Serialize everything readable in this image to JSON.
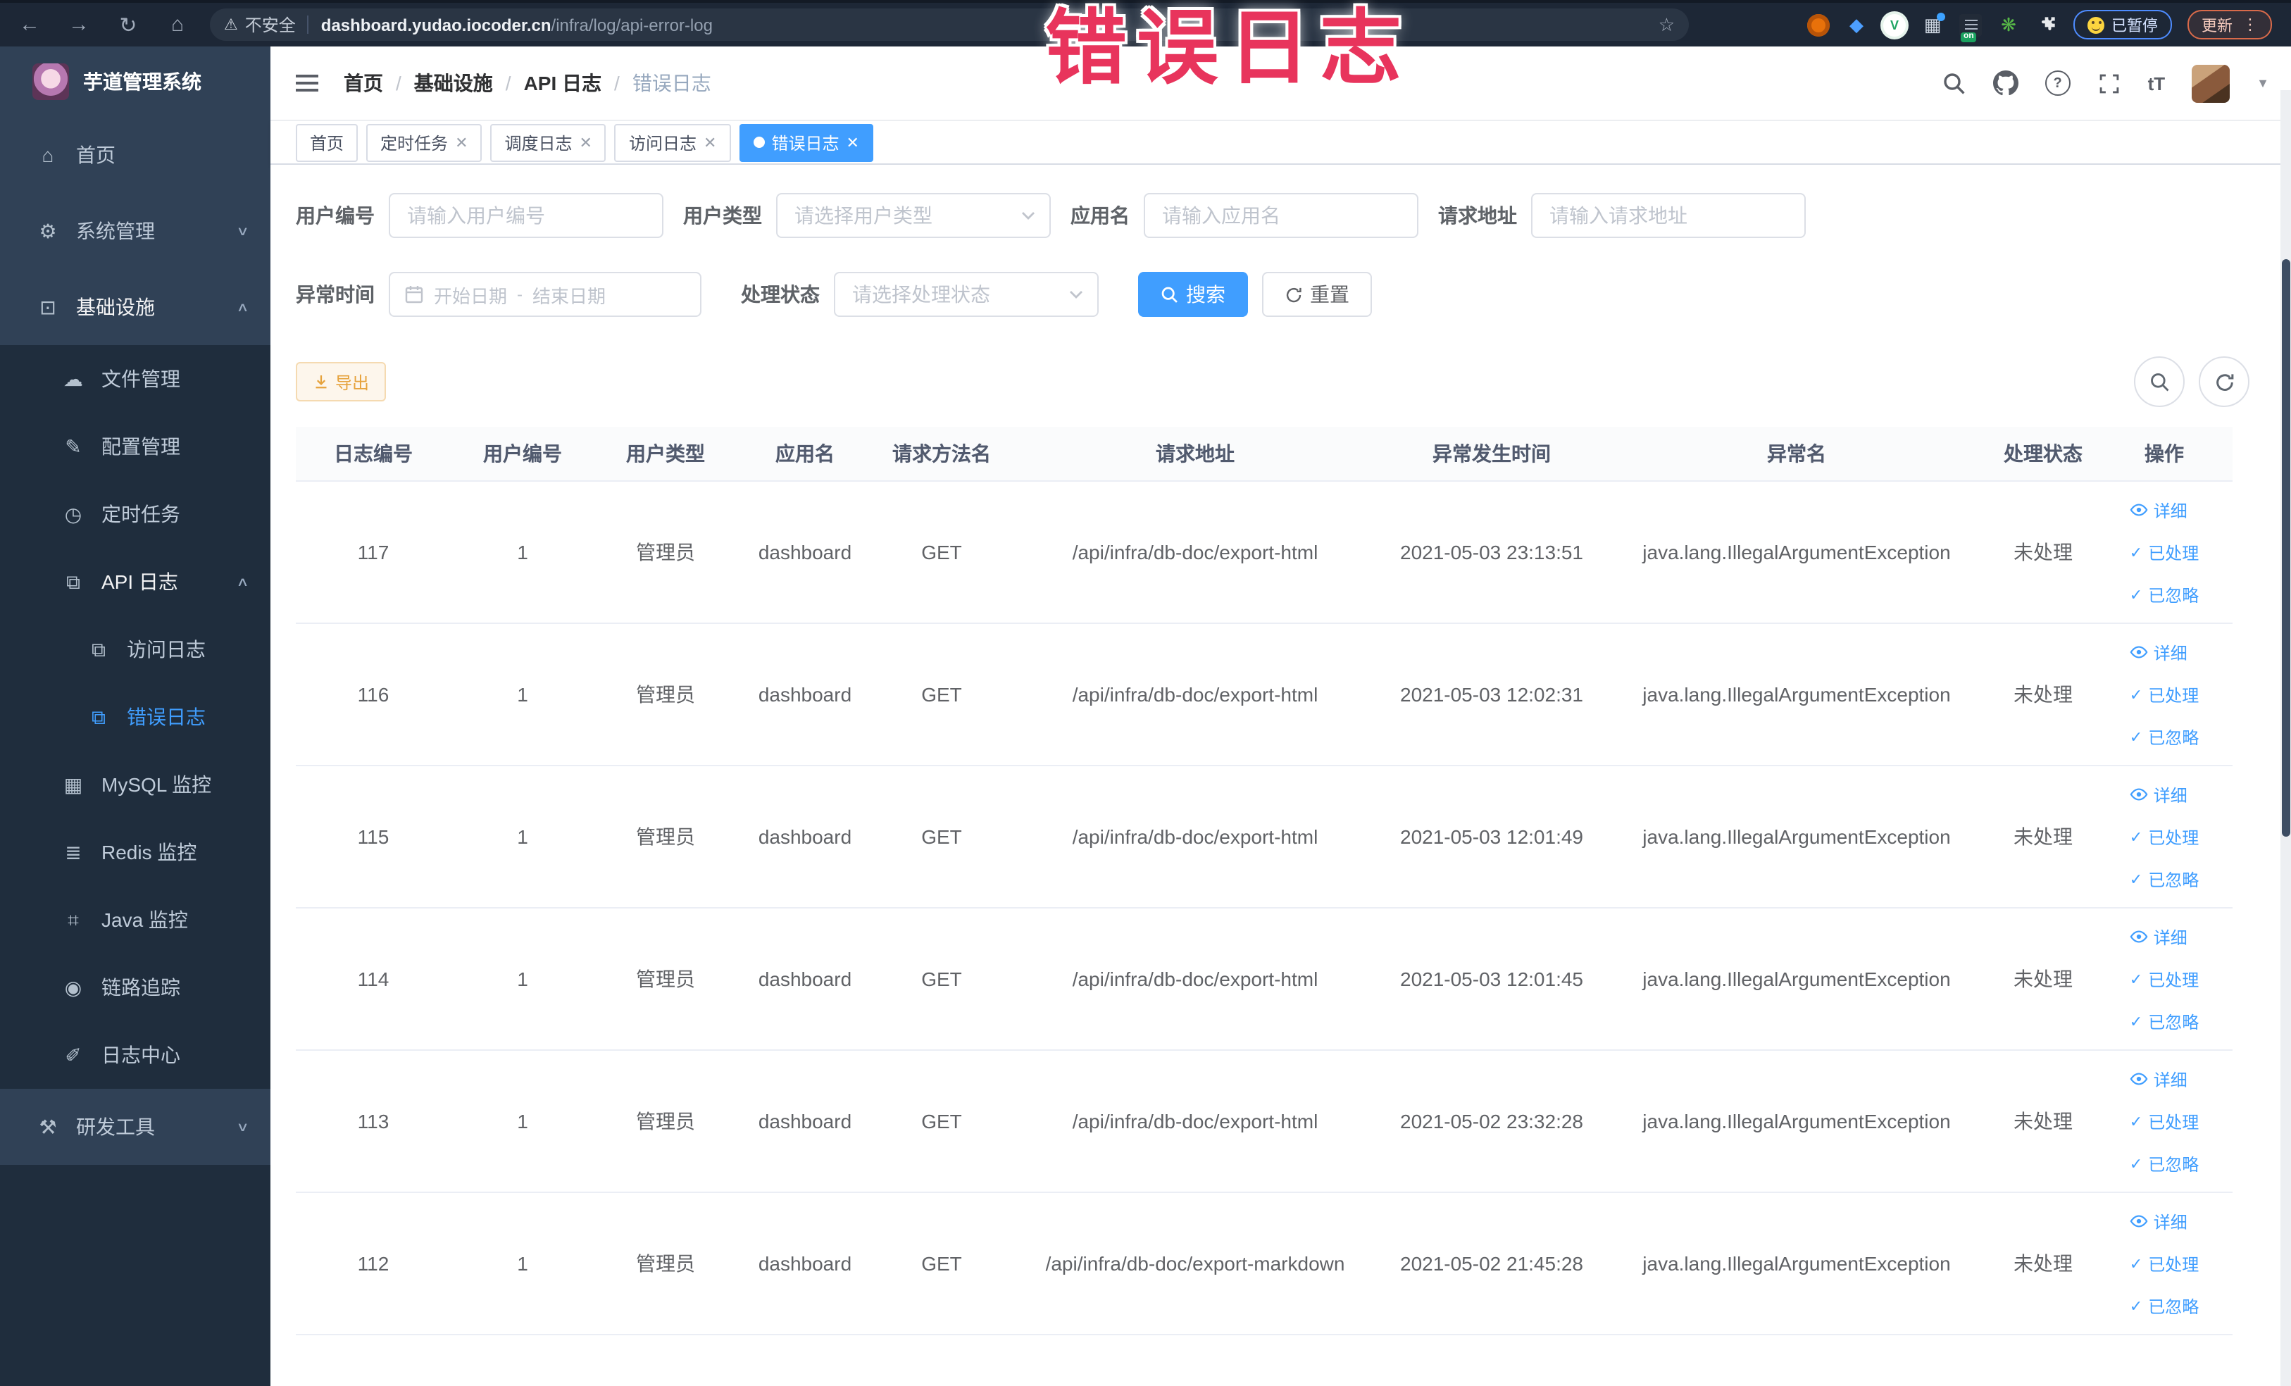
{
  "browser": {
    "security": "不安全",
    "url_host": "dashboard.yudao.iocoder.cn",
    "url_path": "/infra/log/api-error-log",
    "paused_label": "已暂停",
    "update_label": "更新",
    "on_label": "on",
    "kebab": "⋮"
  },
  "overlay_title": "错误日志",
  "sidebar": {
    "title": "芋道管理系统",
    "items": [
      {
        "label": "首页",
        "icon": "home-icon"
      },
      {
        "label": "系统管理",
        "icon": "gear-icon"
      },
      {
        "label": "基础设施",
        "icon": "monitor-icon"
      },
      {
        "label": "文件管理",
        "icon": "cloud-icon"
      },
      {
        "label": "配置管理",
        "icon": "edit-icon"
      },
      {
        "label": "定时任务",
        "icon": "clock-icon"
      },
      {
        "label": "API 日志",
        "icon": "log-icon"
      },
      {
        "label": "访问日志",
        "icon": "log-icon"
      },
      {
        "label": "错误日志",
        "icon": "log-icon"
      },
      {
        "label": "MySQL 监控",
        "icon": "mysql-icon"
      },
      {
        "label": "Redis 监控",
        "icon": "redis-icon"
      },
      {
        "label": "Java 监控",
        "icon": "java-icon"
      },
      {
        "label": "链路追踪",
        "icon": "trace-icon"
      },
      {
        "label": "日志中心",
        "icon": "log-center-icon"
      },
      {
        "label": "研发工具",
        "icon": "toolbox-icon"
      }
    ]
  },
  "breadcrumb": [
    "首页",
    "基础设施",
    "API 日志",
    "错误日志"
  ],
  "breadcrumb_separator": "/",
  "tabs": [
    {
      "label": "首页",
      "closable": false,
      "active": false
    },
    {
      "label": "定时任务",
      "closable": true,
      "active": false
    },
    {
      "label": "调度日志",
      "closable": true,
      "active": false
    },
    {
      "label": "访问日志",
      "closable": true,
      "active": false
    },
    {
      "label": "错误日志",
      "closable": true,
      "active": true
    }
  ],
  "filters": {
    "user_id_label": "用户编号",
    "user_id_placeholder": "请输入用户编号",
    "user_type_label": "用户类型",
    "user_type_placeholder": "请选择用户类型",
    "app_name_label": "应用名",
    "app_name_placeholder": "请输入应用名",
    "request_url_label": "请求地址",
    "request_url_placeholder": "请输入请求地址",
    "exception_time_label": "异常时间",
    "start_date_placeholder": "开始日期",
    "end_date_placeholder": "结束日期",
    "date_separator": "-",
    "process_status_label": "处理状态",
    "process_status_placeholder": "请选择处理状态",
    "search_label": "搜索",
    "reset_label": "重置"
  },
  "toolbar": {
    "export_label": "导出"
  },
  "table": {
    "headers": [
      "日志编号",
      "用户编号",
      "用户类型",
      "应用名",
      "请求方法名",
      "请求地址",
      "异常发生时间",
      "异常名",
      "处理状态",
      "操作"
    ],
    "actions": {
      "detail": "详细",
      "processed": "已处理",
      "ignored": "已忽略"
    },
    "rows": [
      {
        "log_id": "117",
        "user_id": "1",
        "user_type": "管理员",
        "app_name": "dashboard",
        "method": "GET",
        "url": "/api/infra/db-doc/export-html",
        "time": "2021-05-03 23:13:51",
        "exception": "java.lang.IllegalArgumentException",
        "status": "未处理"
      },
      {
        "log_id": "116",
        "user_id": "1",
        "user_type": "管理员",
        "app_name": "dashboard",
        "method": "GET",
        "url": "/api/infra/db-doc/export-html",
        "time": "2021-05-03 12:02:31",
        "exception": "java.lang.IllegalArgumentException",
        "status": "未处理"
      },
      {
        "log_id": "115",
        "user_id": "1",
        "user_type": "管理员",
        "app_name": "dashboard",
        "method": "GET",
        "url": "/api/infra/db-doc/export-html",
        "time": "2021-05-03 12:01:49",
        "exception": "java.lang.IllegalArgumentException",
        "status": "未处理"
      },
      {
        "log_id": "114",
        "user_id": "1",
        "user_type": "管理员",
        "app_name": "dashboard",
        "method": "GET",
        "url": "/api/infra/db-doc/export-html",
        "time": "2021-05-03 12:01:45",
        "exception": "java.lang.IllegalArgumentException",
        "status": "未处理"
      },
      {
        "log_id": "113",
        "user_id": "1",
        "user_type": "管理员",
        "app_name": "dashboard",
        "method": "GET",
        "url": "/api/infra/db-doc/export-html",
        "time": "2021-05-02 23:32:28",
        "exception": "java.lang.IllegalArgumentException",
        "status": "未处理"
      },
      {
        "log_id": "112",
        "user_id": "1",
        "user_type": "管理员",
        "app_name": "dashboard",
        "method": "GET",
        "url": "/api/infra/db-doc/export-markdown",
        "time": "2021-05-02 21:45:28",
        "exception": "java.lang.IllegalArgumentException",
        "status": "未处理"
      }
    ]
  },
  "colors": {
    "accent_blue": "#409eff",
    "warning_orange": "#e6a23c",
    "sidebar_bg": "#304156",
    "sidebar_sub_bg": "#1f2d3d",
    "sidebar_text": "#bfcbd9",
    "chrome_bg": "#1d2736",
    "overlay_red": "#e8345c",
    "table_text": "#606266",
    "header_text": "#515a6e"
  }
}
